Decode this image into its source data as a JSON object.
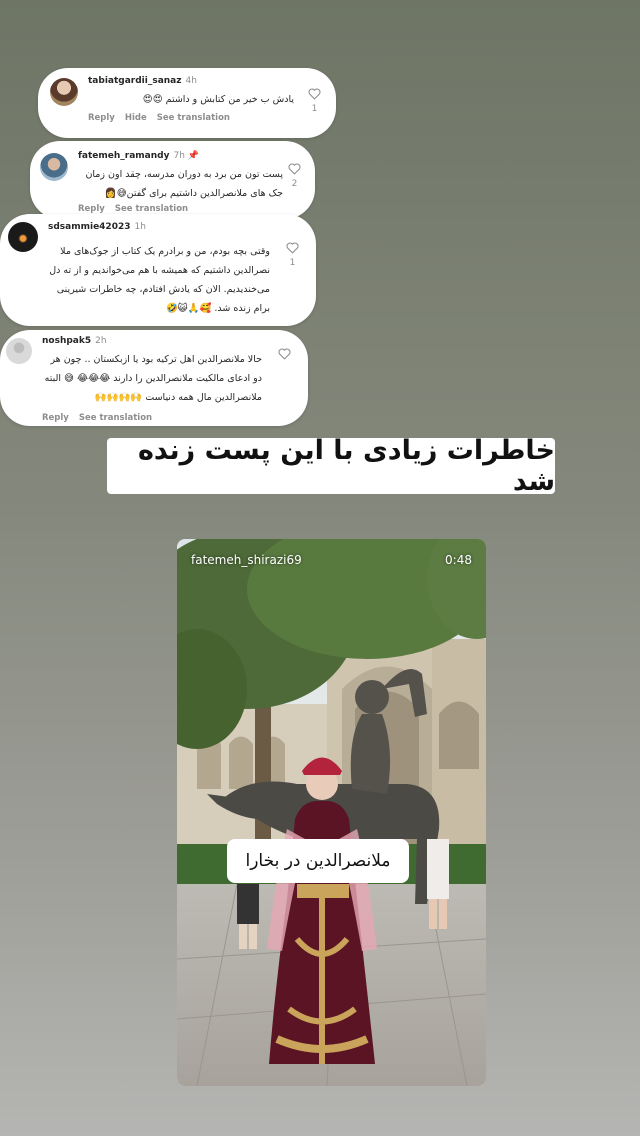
{
  "comments": [
    {
      "username": "tabiatgardii_sanaz",
      "time": "4h",
      "text": "یادش ب خیر من کتابش و داشتم 😍😍",
      "actions": [
        "Reply",
        "Hide",
        "See translation"
      ],
      "likes": "1"
    },
    {
      "username": "fatemeh_ramandy",
      "time": "7h 📌",
      "text": "پست تون من برد به دوران مدرسه، چقد اون زمان جک های ملانصرالدین داشتیم برای گفتن😅👩",
      "actions": [
        "Reply",
        "See translation"
      ],
      "likes": "2"
    },
    {
      "username": "sdsammie42023",
      "time": "1h",
      "text": "وقتی بچه بودم، من و برادرم یک کتاب از جوک‌های ملا نصرالدین داشتیم که همیشه با هم می‌خواندیم و از ته دل می‌خندیدیم. الان که یادش افتادم، چه خاطرات شیرینی برام زنده شد. 🥰🙏😺🤣",
      "actions": [],
      "likes": "1"
    },
    {
      "username": "noshpak5",
      "time": "2h",
      "text": "حالا ملانصرالدین اهل ترکیه بود یا ازبکستان .. چون هر دو ادعای مالکیت ملانصرالدین را دارند 😂😂😂 😅 البته ملانصرالدین مال همه دنیاست 🙌🙌🙌🙌",
      "actions": [
        "Reply",
        "See translation"
      ],
      "likes": ""
    }
  ],
  "headline": "خاطرات زیادی با این پست زنده شد",
  "story": {
    "username": "fatemeh_shirazi69",
    "time": "0:48",
    "caption": "ملانصرالدین در بخارا"
  },
  "icons": {
    "like": "heart-outline-icon",
    "pin": "pin-icon"
  },
  "colors": {
    "text": "#262626",
    "muted": "#8e8e8e",
    "card": "#ffffff"
  }
}
